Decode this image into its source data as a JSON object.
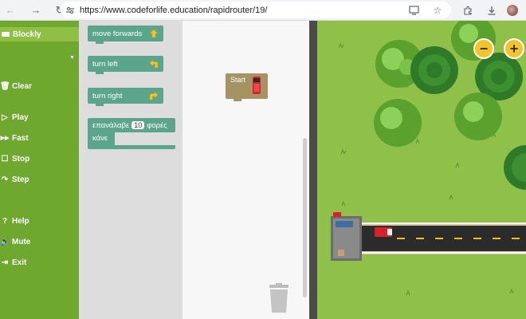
{
  "browser": {
    "url": "https://www.codeforlife.education/rapidrouter/19/"
  },
  "menu": {
    "blockly_label": "Blockly",
    "clear_label": "Clear",
    "play_label": "Play",
    "fast_label": "Fast",
    "stop_label": "Stop",
    "step_label": "Step",
    "help_label": "Help",
    "mute_label": "Mute",
    "exit_label": "Exit"
  },
  "toolbox": {
    "move_forwards": "move forwards",
    "turn_left": "turn left",
    "turn_right": "turn right",
    "repeat_prefix": "επανάλαβε",
    "repeat_count": "10",
    "repeat_suffix": "φορές",
    "repeat_do": "κάνε"
  },
  "workspace": {
    "start_label": "Start"
  },
  "map": {
    "zoom_out": "−",
    "zoom_in": "+"
  },
  "colors": {
    "menu_green": "#6ea82f",
    "block_teal": "#5ba58c",
    "start_block": "#a69363",
    "grass": "#8fc04a",
    "zoom_yellow": "#f3c32a"
  }
}
